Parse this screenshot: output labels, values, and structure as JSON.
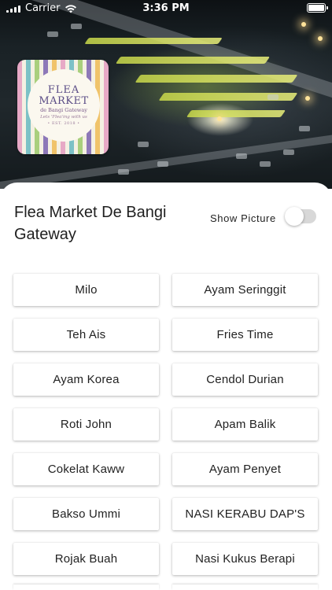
{
  "status_bar": {
    "carrier": "Carrier",
    "time": "3:36 PM",
    "wifi_icon": "wifi-icon",
    "battery_icon": "battery-icon"
  },
  "logo": {
    "line1": "FLEA",
    "line2": "MARKET",
    "line3": "de Bangi Gateway",
    "line4": "Lets 'Flea'ing with us",
    "line5": "• EST. 2018 •"
  },
  "header": {
    "title": "Flea Market De Bangi Gateway",
    "toggle_label": "Show Picture",
    "toggle_on": false
  },
  "stalls": [
    "Milo",
    "Ayam Seringgit",
    "Teh Ais",
    "Fries Time",
    "Ayam Korea",
    "Cendol Durian",
    "Roti John",
    "Apam Balik",
    "Cokelat Kaww",
    "Ayam Penyet",
    "Bakso Ummi",
    "NASI KERABU DAP'S",
    "Rojak Buah",
    "Nasi Kukus Berapi"
  ],
  "colors": {
    "accent_text": "#5a4c86",
    "toggle_track": "#d8d8d8",
    "market_lights": "#d6e35a"
  }
}
